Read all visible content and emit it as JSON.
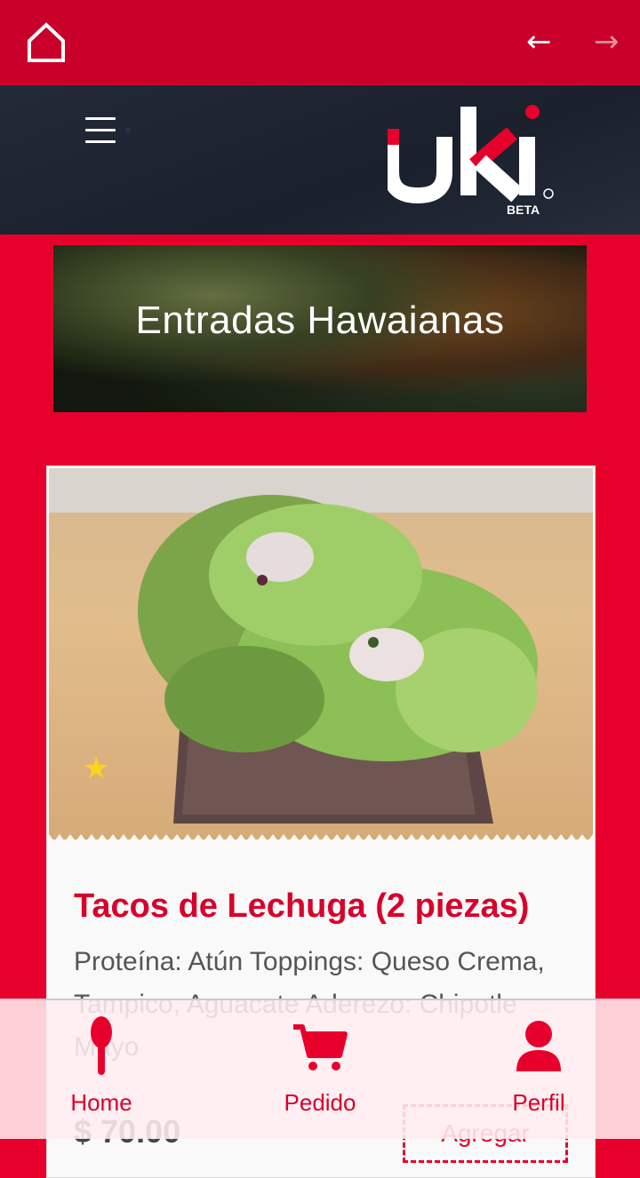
{
  "topbar": {
    "back_arrow": "←",
    "forward_arrow": "→"
  },
  "header": {
    "logo_text": "uki",
    "logo_badge": "BETA"
  },
  "banner": {
    "title": "Entradas Hawaianas"
  },
  "item": {
    "title": "Tacos de Lechuga (2 piezas)",
    "description": "Proteína: Atún Toppings: Queso Crema, Tampico, Aguacate Aderezo: Chipotle Mayo",
    "price": "$ 70.00",
    "add_label": "Agregar",
    "favorite_icon": "star-icon"
  },
  "bottom_nav": {
    "home": "Home",
    "order": "Pedido",
    "profile": "Perfil"
  },
  "colors": {
    "brand_red": "#e8002c",
    "dark_red": "#c8002a",
    "header_dark": "#1e2533"
  }
}
